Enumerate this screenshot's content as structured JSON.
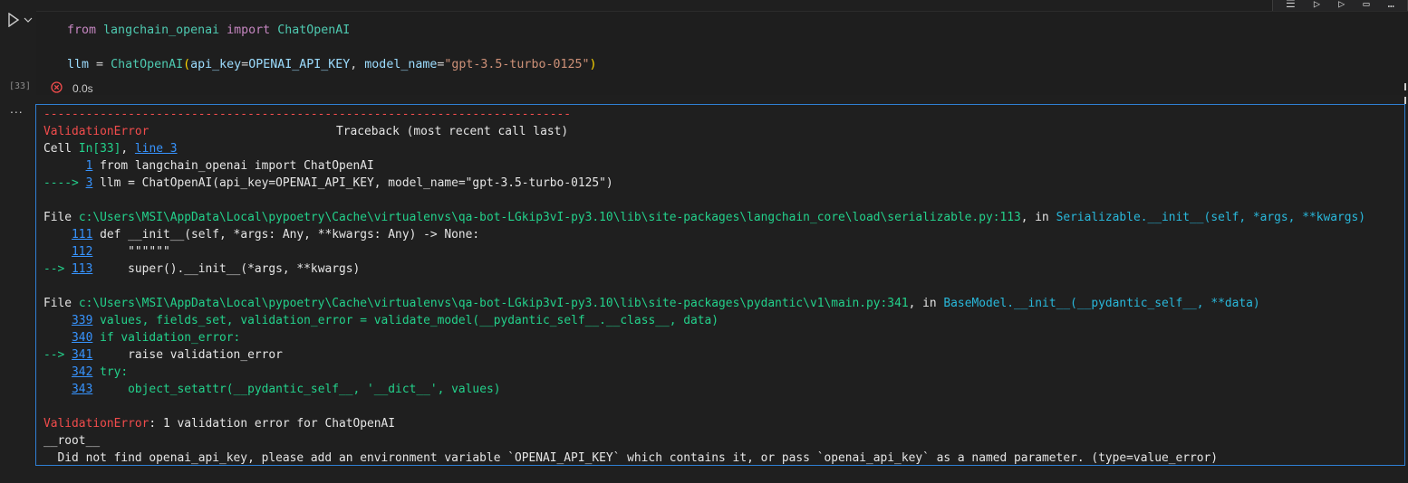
{
  "cell": {
    "execution_count": "[33]",
    "exec_time": "0.0s",
    "code": {
      "line1": {
        "kw1": "from",
        "module": "langchain_openai",
        "kw2": "import",
        "cls": "ChatOpenAI"
      },
      "line2": {
        "var": "llm",
        "eq": " = ",
        "cls": "ChatOpenAI",
        "open": "(",
        "kw_api": "api_key",
        "eq2": "=",
        "api_val": "OPENAI_API_KEY",
        "sep": ", ",
        "kw_model": "model_name",
        "eq3": "=",
        "model_val": "\"gpt-3.5-turbo-0125\"",
        "close": ")"
      }
    }
  },
  "toolbar": {
    "icons": [
      "run-by-line-icon",
      "execute-above-icon",
      "execute-below-icon",
      "split-cell-icon",
      "more-icon"
    ]
  },
  "output": {
    "menu": "...",
    "dashes": "---------------------------------------------------------------------------",
    "error_name": "ValidationError",
    "traceback_label": "Traceback (most recent call last)",
    "cell_prefix": "Cell ",
    "cell_in": "In[33]",
    "cell_sep": ", ",
    "cell_line": "line 3",
    "t1_num": "1",
    "t1_code": " from langchain_openai import ChatOpenAI",
    "t3_arrow": "----> ",
    "t3_num": "3",
    "t3_code": " llm = ChatOpenAI(api_key=OPENAI_API_KEY, model_name=\"gpt-3.5-turbo-0125\")",
    "file1_prefix": "File ",
    "file1_path": "c:\\Users\\MSI\\AppData\\Local\\pypoetry\\Cache\\virtualenvs\\qa-bot-LGkip3vI-py3.10\\lib\\site-packages\\langchain_core\\load\\serializable.py:113",
    "file1_in": ", in ",
    "file1_func": "Serializable.__init__(self, *args, **kwargs)",
    "f1_111_num": "111",
    "f1_111_code": " def __init__(self, *args: Any, **kwargs: Any) -> None:",
    "f1_112_num": "112",
    "f1_112_code": "     \"\"\"\"\"\"",
    "f1_113_arrow": "--> ",
    "f1_113_num": "113",
    "f1_113_code": "     super().__init__(*args, **kwargs)",
    "file2_prefix": "File ",
    "file2_path": "c:\\Users\\MSI\\AppData\\Local\\pypoetry\\Cache\\virtualenvs\\qa-bot-LGkip3vI-py3.10\\lib\\site-packages\\pydantic\\v1\\main.py:341",
    "file2_in": ", in ",
    "file2_func": "BaseModel.__init__(__pydantic_self__, **data)",
    "f2_339_num": "339",
    "f2_339_code": " values, fields_set, validation_error = validate_model(__pydantic_self__.__class__, data)",
    "f2_340_num": "340",
    "f2_340_code": " if validation_error:",
    "f2_341_arrow": "--> ",
    "f2_341_num": "341",
    "f2_341_code": "     raise validation_error",
    "f2_342_num": "342",
    "f2_342_code": " try:",
    "f2_343_num": "343",
    "f2_343_code": "     object_setattr(__pydantic_self__, '__dict__', values)",
    "final_error_name": "ValidationError",
    "final_error_msg": ": 1 validation error for ChatOpenAI",
    "root": "__root__",
    "detail": "  Did not find openai_api_key, please add an environment variable `OPENAI_API_KEY` which contains it, or pass `openai_api_key` as a named parameter. (type=value_error)"
  },
  "colors": {
    "error_red": "#f14c4c",
    "path_green": "#23d18b",
    "func_blue": "#3b8eea",
    "link_blue": "#3794ff",
    "focus_border": "#2f7fd4"
  }
}
